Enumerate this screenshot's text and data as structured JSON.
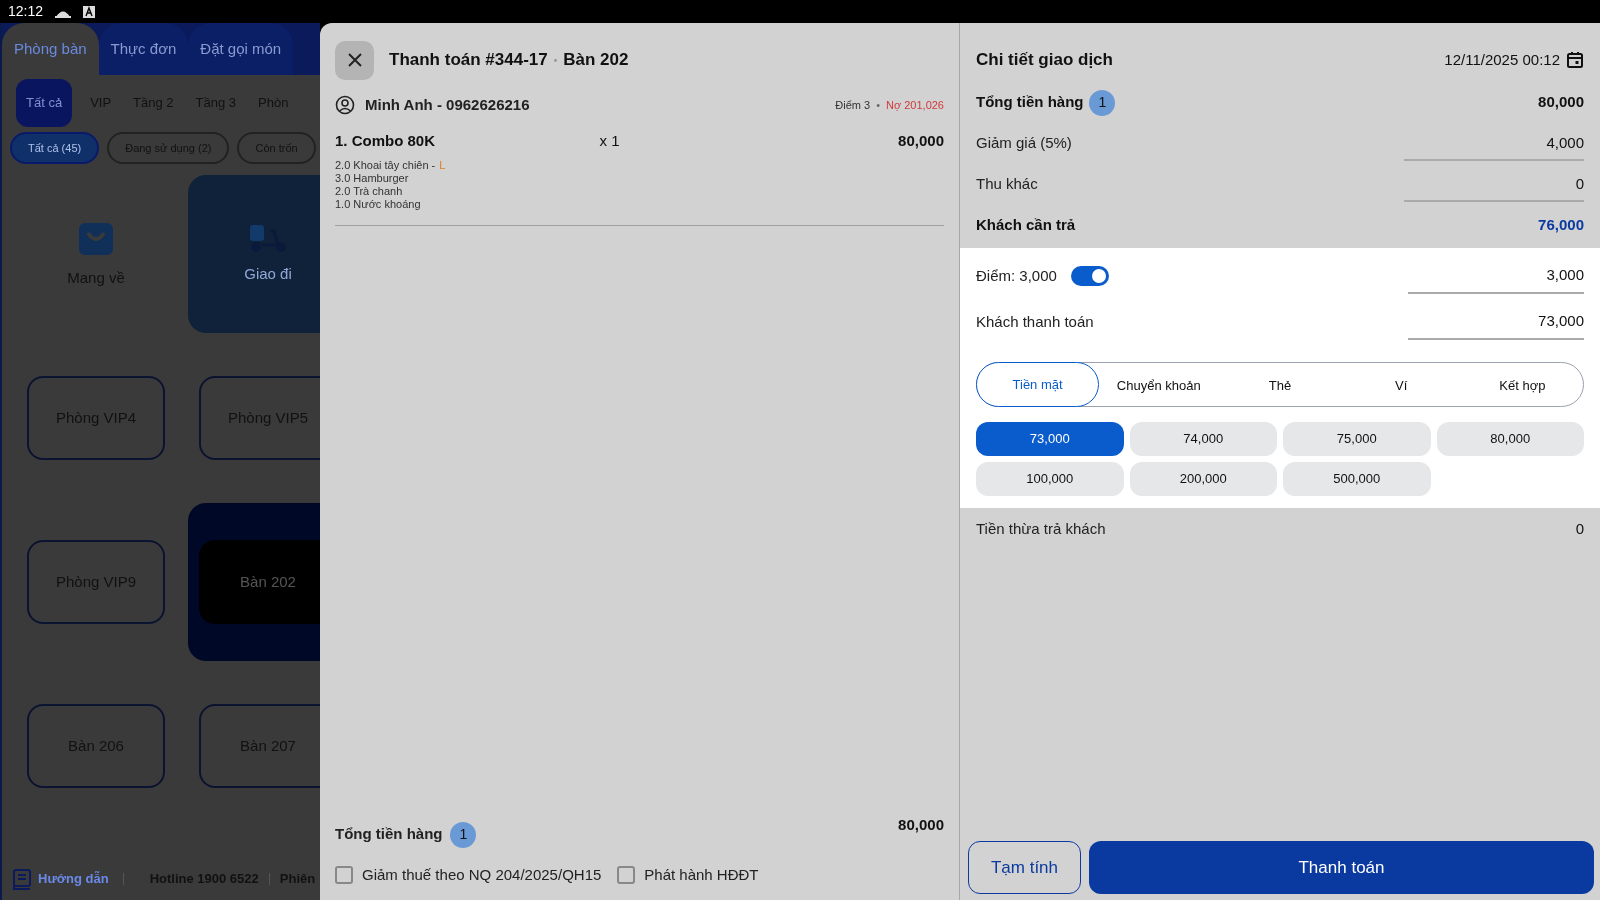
{
  "status_bar": {
    "time": "12:12"
  },
  "background": {
    "tabs": [
      {
        "label": "Phòng bàn",
        "selected": true
      },
      {
        "label": "Thực đơn",
        "selected": false
      },
      {
        "label": "Đặt gọi món",
        "selected": false
      }
    ],
    "floor_filters": [
      {
        "label": "Tất cả",
        "selected": true
      },
      {
        "label": "VIP",
        "selected": false
      },
      {
        "label": "Tầng 2",
        "selected": false
      },
      {
        "label": "Tầng 3",
        "selected": false
      },
      {
        "label": "Phòn",
        "selected": false
      }
    ],
    "status_filters": [
      {
        "label": "Tất cả (45)",
        "selected": true
      },
      {
        "label": "Đang sử dụng (2)",
        "selected": false
      },
      {
        "label": "Còn trốn",
        "selected": false
      }
    ],
    "tiles": [
      {
        "label": "Mang về",
        "kind": "takeaway",
        "selected": false
      },
      {
        "label": "Giao đi",
        "kind": "delivery",
        "selected": false
      },
      {
        "label": "Phòng VIP4",
        "kind": "table",
        "selected": false
      },
      {
        "label": "Phòng VIP5",
        "kind": "table",
        "selected": false
      },
      {
        "label": "Phòng VIP9",
        "kind": "table",
        "selected": false
      },
      {
        "label": "Bàn 202",
        "kind": "table",
        "selected": true
      },
      {
        "label": "Bàn 206",
        "kind": "table",
        "selected": false
      },
      {
        "label": "Bàn 207",
        "kind": "table",
        "selected": false
      }
    ],
    "footer": {
      "guide": "Hướng dẫn",
      "hotline": "Hotline 1900 6522",
      "version": "Phiên"
    }
  },
  "payment": {
    "title": "Thanh toán #344-17",
    "separator": "•",
    "table": "Bàn 202",
    "customer": {
      "name": "Minh Anh - 0962626216",
      "points": "Điểm 3",
      "separator": "•",
      "debt": "Nợ 201,026"
    },
    "items": [
      {
        "name": "1. Combo 80K",
        "qty": "x 1",
        "price": "80,000",
        "components": [
          {
            "text": "2.0 Khoai tây chiên -",
            "variant": "L"
          },
          {
            "text": "3.0 Hamburger"
          },
          {
            "text": "2.0 Trà chanh"
          },
          {
            "text": "1.0 Nước khoáng"
          }
        ]
      }
    ],
    "summary": {
      "label": "Tổng tiền hàng",
      "count": "1",
      "amount": "80,000"
    },
    "options": [
      {
        "label": "Giảm thuế theo NQ 204/2025/QH15",
        "checked": false
      },
      {
        "label": "Phát hành HĐĐT",
        "checked": false
      }
    ]
  },
  "details": {
    "title": "Chi tiết giao dịch",
    "datetime": "12/11/2025 00:12",
    "rows": [
      {
        "kind": "total",
        "label": "Tổng tiền hàng",
        "count": "1",
        "value": "80,000"
      },
      {
        "kind": "field",
        "label": "Giảm giá (5%)",
        "value": "4,000"
      },
      {
        "kind": "field",
        "label": "Thu khác",
        "value": "0"
      },
      {
        "kind": "due",
        "label": "Khách cần trả",
        "value": "76,000"
      }
    ],
    "points": {
      "label": "Điểm: 3,000",
      "on": true,
      "value": "3,000"
    },
    "paid": {
      "label": "Khách thanh toán",
      "value": "73,000"
    },
    "methods": [
      {
        "label": "Tiền mặt",
        "selected": true
      },
      {
        "label": "Chuyển khoản",
        "selected": false
      },
      {
        "label": "Thẻ",
        "selected": false
      },
      {
        "label": "Ví",
        "selected": false
      },
      {
        "label": "Kết hợp",
        "selected": false
      }
    ],
    "quick_amounts": [
      {
        "label": "73,000",
        "selected": true
      },
      {
        "label": "74,000",
        "selected": false
      },
      {
        "label": "75,000",
        "selected": false
      },
      {
        "label": "80,000",
        "selected": false
      },
      {
        "label": "100,000",
        "selected": false
      },
      {
        "label": "200,000",
        "selected": false
      },
      {
        "label": "500,000",
        "selected": false
      }
    ],
    "change": {
      "label": "Tiền thừa trả khách",
      "value": "0"
    },
    "buttons": [
      {
        "label": "Tạm tính",
        "kind": "secondary"
      },
      {
        "label": "Thanh toán",
        "kind": "primary"
      }
    ]
  }
}
